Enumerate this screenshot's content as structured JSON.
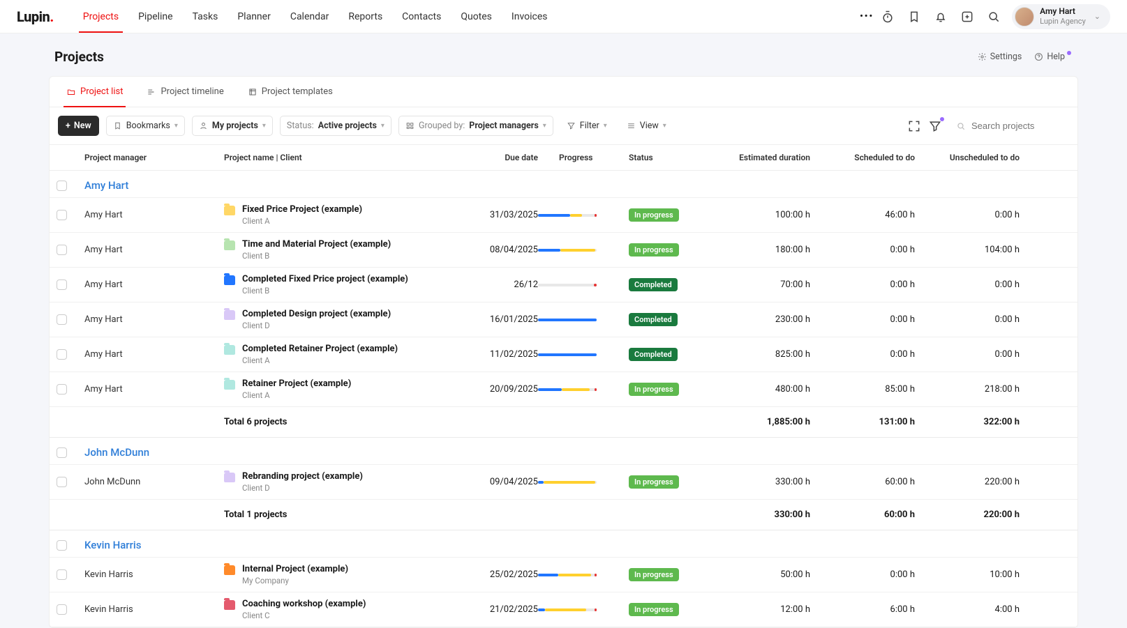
{
  "app": {
    "logo": "Lupin",
    "logo_dot": "."
  },
  "nav": {
    "items": [
      "Projects",
      "Pipeline",
      "Tasks",
      "Planner",
      "Calendar",
      "Reports",
      "Contacts",
      "Quotes",
      "Invoices"
    ],
    "active_index": 0
  },
  "user": {
    "name": "Amy Hart",
    "org": "Lupin Agency"
  },
  "page": {
    "title": "Projects",
    "settings_label": "Settings",
    "help_label": "Help"
  },
  "tabs": {
    "items": [
      {
        "label": "Project list"
      },
      {
        "label": "Project timeline"
      },
      {
        "label": "Project templates"
      }
    ],
    "active_index": 0
  },
  "toolbar": {
    "new_label": "New",
    "bookmarks_label": "Bookmarks",
    "my_projects_label": "My projects",
    "status_prefix": "Status:",
    "status_value": "Active projects",
    "grouped_prefix": "Grouped by:",
    "grouped_value": "Project managers",
    "filter_label": "Filter",
    "view_label": "View",
    "search_placeholder": "Search projects"
  },
  "columns": {
    "pm": "Project manager",
    "project": "Project name | Client",
    "due": "Due date",
    "progress": "Progress",
    "status": "Status",
    "estimated": "Estimated duration",
    "scheduled": "Scheduled to do",
    "unscheduled": "Unscheduled to do"
  },
  "groups": [
    {
      "name": "Amy Hart",
      "rows": [
        {
          "pm": "Amy Hart",
          "folder": "#ffd766",
          "project": "Fixed Price Project (example)",
          "client": "Client A",
          "due": "31/03/2025",
          "progress": {
            "blue": 55,
            "yellow": 20,
            "red": 3
          },
          "status": "In progress",
          "status_cls": "inprog",
          "est": "100:00 h",
          "sch": "46:00 h",
          "uns": "0:00 h"
        },
        {
          "pm": "Amy Hart",
          "folder": "#b7e4b0",
          "project": "Time and Material Project (example)",
          "client": "Client B",
          "due": "08/04/2025",
          "progress": {
            "blue": 38,
            "yellow": 60,
            "red": 0
          },
          "status": "In progress",
          "status_cls": "inprog",
          "est": "180:00 h",
          "sch": "0:00 h",
          "uns": "104:00 h"
        },
        {
          "pm": "Amy Hart",
          "folder": "#2176ff",
          "project": "Completed Fixed Price project (example)",
          "client": "Client B",
          "due": "26/12",
          "progress": {
            "blue": 0,
            "yellow": 0,
            "red": 5
          },
          "status": "Completed",
          "status_cls": "done",
          "est": "70:00 h",
          "sch": "0:00 h",
          "uns": "0:00 h"
        },
        {
          "pm": "Amy Hart",
          "folder": "#d9c8f7",
          "project": "Completed Design project (example)",
          "client": "Client D",
          "due": "16/01/2025",
          "progress": {
            "blue": 100,
            "yellow": 0,
            "red": 0
          },
          "status": "Completed",
          "status_cls": "done",
          "est": "230:00 h",
          "sch": "0:00 h",
          "uns": "0:00 h"
        },
        {
          "pm": "Amy Hart",
          "folder": "#b0e8e0",
          "project": "Completed Retainer Project (example)",
          "client": "Client A",
          "due": "11/02/2025",
          "progress": {
            "blue": 100,
            "yellow": 0,
            "red": 0
          },
          "status": "Completed",
          "status_cls": "done",
          "est": "825:00 h",
          "sch": "0:00 h",
          "uns": "0:00 h"
        },
        {
          "pm": "Amy Hart",
          "folder": "#b0e8e0",
          "project": "Retainer Project (example)",
          "client": "Client A",
          "due": "20/09/2025",
          "progress": {
            "blue": 40,
            "yellow": 48,
            "red": 3
          },
          "status": "In progress",
          "status_cls": "inprog",
          "est": "480:00 h",
          "sch": "85:00 h",
          "uns": "218:00 h"
        }
      ],
      "total": {
        "label": "Total 6 projects",
        "est": "1,885:00 h",
        "sch": "131:00 h",
        "uns": "322:00 h"
      }
    },
    {
      "name": "John McDunn",
      "rows": [
        {
          "pm": "John McDunn",
          "folder": "#d9c8f7",
          "project": "Rebranding project (example)",
          "client": "Client D",
          "due": "09/04/2025",
          "progress": {
            "blue": 10,
            "yellow": 88,
            "red": 0
          },
          "status": "In progress",
          "status_cls": "inprog",
          "est": "330:00 h",
          "sch": "60:00 h",
          "uns": "220:00 h"
        }
      ],
      "total": {
        "label": "Total 1 projects",
        "est": "330:00 h",
        "sch": "60:00 h",
        "uns": "220:00 h"
      }
    },
    {
      "name": "Kevin Harris",
      "rows": [
        {
          "pm": "Kevin Harris",
          "folder": "#ff8a2a",
          "project": "Internal Project (example)",
          "client": "My Company",
          "due": "25/02/2025",
          "progress": {
            "blue": 35,
            "yellow": 55,
            "red": 3
          },
          "status": "In progress",
          "status_cls": "inprog",
          "est": "50:00 h",
          "sch": "0:00 h",
          "uns": "10:00 h"
        },
        {
          "pm": "Kevin Harris",
          "folder": "#e45a6d",
          "project": "Coaching workshop (example)",
          "client": "Client C",
          "due": "21/02/2025",
          "progress": {
            "blue": 12,
            "yellow": 70,
            "red": 3
          },
          "status": "In progress",
          "status_cls": "inprog",
          "est": "12:00 h",
          "sch": "6:00 h",
          "uns": "4:00 h"
        }
      ],
      "total": null
    }
  ]
}
